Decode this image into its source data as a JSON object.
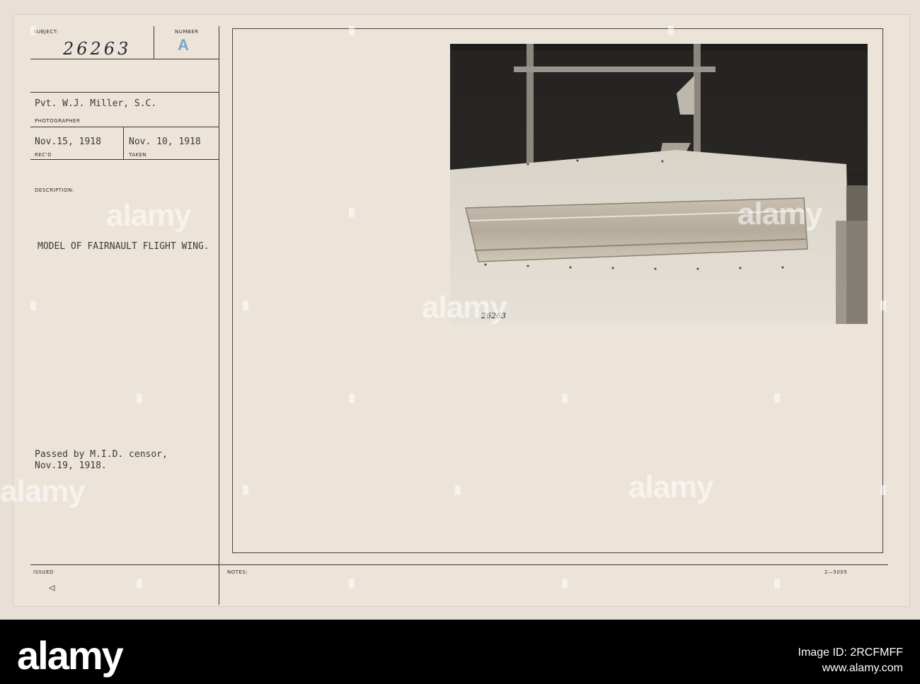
{
  "card": {
    "subject_label": "SUBJECT:",
    "subject_number": "26263",
    "number_label": "NUMBER",
    "number_value": "A",
    "photographer": "Pvt. W.J. Miller, S.C.",
    "photographer_label": "PHOTOGRAPHER",
    "received_date": "Nov.15, 1918",
    "received_label": "REC'D",
    "taken_date": "Nov. 10, 1918",
    "taken_label": "TAKEN",
    "description_label": "DESCRIPTION:",
    "description": "MODEL OF FAIRNAULT FLIGHT WING.",
    "censor_line1": "Passed by M.I.D. censor,",
    "censor_line2": "Nov.19, 1918.",
    "issued_label": "ISSUED",
    "issued_mark": "◁",
    "notes_label": "NOTES:",
    "form_code": "2—5005",
    "photo_inscription": "26263"
  },
  "watermark": {
    "text": "alamy"
  },
  "footer": {
    "logo": "alamy",
    "image_id": "Image ID: 2RCFMFF",
    "url": "www.alamy.com"
  },
  "colors": {
    "card_background": "#ece3d9",
    "footer_background": "#000000",
    "stamp_blue": "#7aa6c7"
  }
}
